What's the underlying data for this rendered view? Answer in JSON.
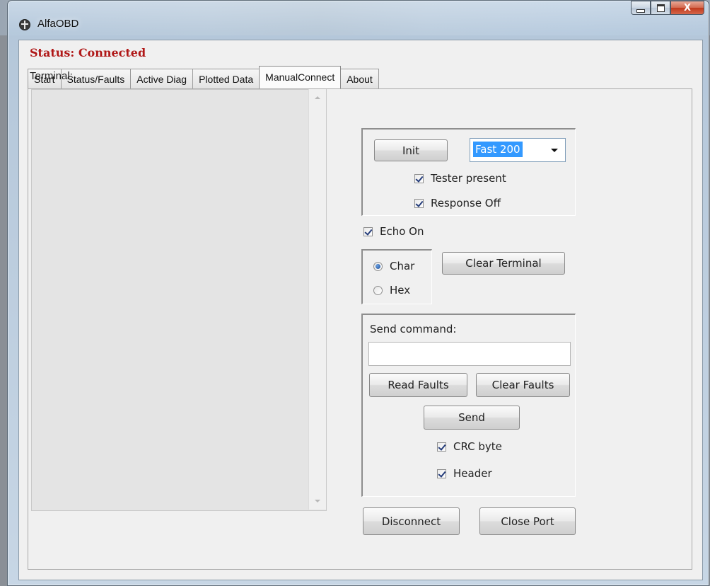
{
  "window": {
    "title": "AlfaOBD",
    "close_glyph": "X"
  },
  "status": "Status: Connected",
  "tabs": [
    {
      "label": "Start"
    },
    {
      "label": "Status/Faults"
    },
    {
      "label": "Active Diag"
    },
    {
      "label": "Plotted Data"
    },
    {
      "label": "ManualConnect"
    },
    {
      "label": "About"
    }
  ],
  "active_tab": "ManualConnect",
  "terminal": {
    "label": "Terminal:"
  },
  "init_group": {
    "init_label": "Init",
    "speed_selected": "Fast 200",
    "tester_present": {
      "label": "Tester present",
      "checked": true
    },
    "response_off": {
      "label": "Response Off",
      "checked": true
    }
  },
  "echo_on": {
    "label": "Echo On",
    "checked": true
  },
  "mode": {
    "char_label": "Char",
    "hex_label": "Hex",
    "selected": "Char"
  },
  "clear_terminal_label": "Clear Terminal",
  "command_group": {
    "send_command_label": "Send command:",
    "command_value": "",
    "read_faults_label": "Read Faults",
    "clear_faults_label": "Clear Faults",
    "send_label": "Send",
    "crc_byte": {
      "label": "CRC byte",
      "checked": true
    },
    "header": {
      "label": "Header",
      "checked": true
    }
  },
  "disconnect_label": "Disconnect",
  "close_port_label": "Close Port",
  "colors": {
    "status_red": "#b01818",
    "selection_blue": "#3399ff",
    "close_button_red": "#c0391c"
  },
  "icons": {
    "app": "alfa-logo-icon",
    "minimize": "minimize-icon",
    "maximize": "maximize-icon",
    "close": "close-icon"
  }
}
